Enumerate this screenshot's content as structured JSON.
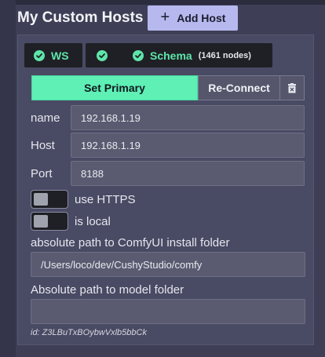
{
  "header": {
    "title": "My Custom Hosts",
    "add_button_label": "Add Host"
  },
  "host": {
    "status": {
      "ws_label": "WS",
      "schema_label": "Schema",
      "node_count": "(1461 nodes)"
    },
    "actions": {
      "set_primary_label": "Set Primary",
      "reconnect_label": "Re-Connect"
    },
    "fields": {
      "name_label": "name",
      "name_value": "192.168.1.19",
      "host_label": "Host",
      "host_value": "192.168.1.19",
      "port_label": "Port",
      "port_value": "8188"
    },
    "toggles": {
      "https_label": "use HTTPS",
      "https_on": false,
      "local_label": "is local",
      "local_on": false
    },
    "install_path_label": "absolute path to ComfyUI install folder",
    "install_path_value": "/Users/loco/dev/CushyStudio/comfy",
    "model_path_label": "Absolute path to model folder",
    "model_path_value": "",
    "id_text": "id: Z3LBuTxBOybwVxlb5bbCk"
  },
  "colors": {
    "accent_green": "#5ef0b4",
    "add_button": "#b6b8ee",
    "card_bg": "#494a63",
    "page_bg": "#3e3f56"
  },
  "icons": [
    "plus-icon",
    "check-circle-icon",
    "trash-icon"
  ]
}
